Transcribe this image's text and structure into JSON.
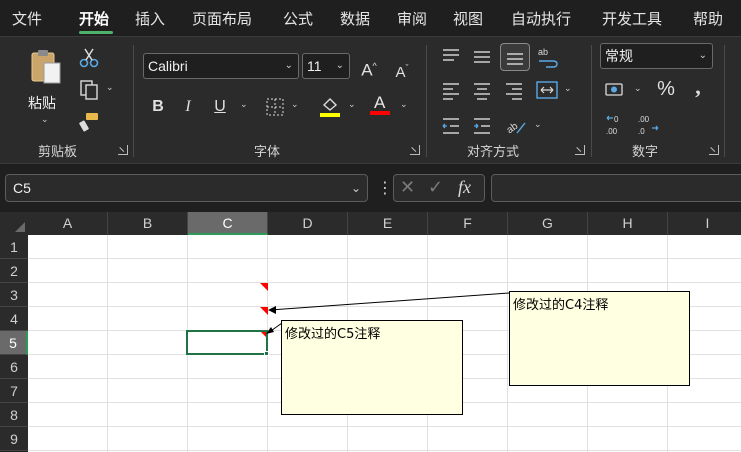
{
  "menu": {
    "items": [
      {
        "label": "文件"
      },
      {
        "label": "开始"
      },
      {
        "label": "插入"
      },
      {
        "label": "页面布局"
      },
      {
        "label": "公式"
      },
      {
        "label": "数据"
      },
      {
        "label": "审阅"
      },
      {
        "label": "视图"
      },
      {
        "label": "自动执行"
      },
      {
        "label": "开发工具"
      },
      {
        "label": "帮助"
      }
    ],
    "active": "开始"
  },
  "ribbon": {
    "clipboard": {
      "paste_label": "粘贴",
      "group_label": "剪贴板"
    },
    "font": {
      "font_name": "Calibri",
      "font_size": "11",
      "group_label": "字体",
      "highlight_color": "#ffff00",
      "font_color": "#ff0000"
    },
    "alignment": {
      "group_label": "对齐方式"
    },
    "number": {
      "format": "常规",
      "group_label": "数字"
    }
  },
  "formula_bar": {
    "name_box": "C5",
    "formula": ""
  },
  "grid": {
    "columns": [
      "A",
      "B",
      "C",
      "D",
      "E",
      "F",
      "G",
      "H",
      "I"
    ],
    "rows": [
      "1",
      "2",
      "3",
      "4",
      "5",
      "6",
      "7",
      "8",
      "9"
    ],
    "selected_cell": "C5",
    "selected_column": "C",
    "selected_row": "5"
  },
  "comments": [
    {
      "cell": "C4",
      "text": "修改过的C4注释"
    },
    {
      "cell": "C5",
      "text": "修改过的C5注释"
    }
  ],
  "colors": {
    "accent": "#2e9a57",
    "comment_bg": "#ffffe1",
    "comment_indicator": "#ff0000"
  }
}
